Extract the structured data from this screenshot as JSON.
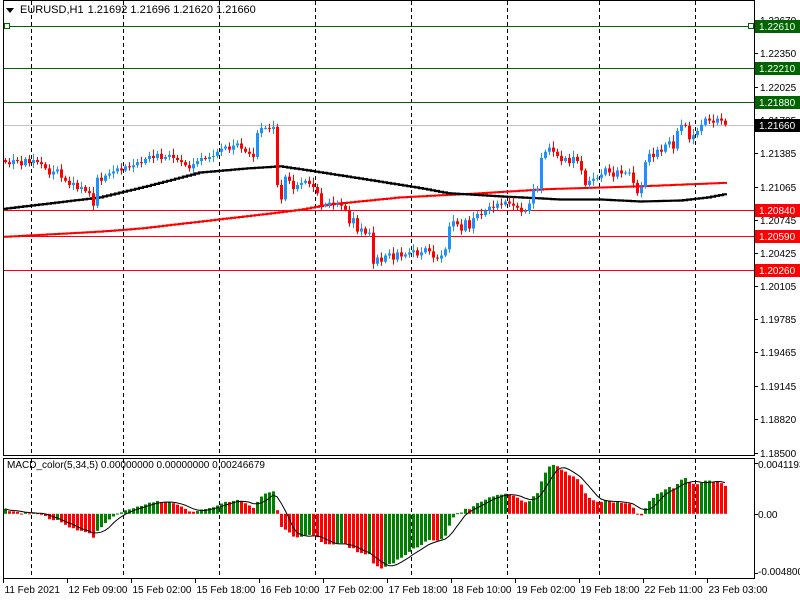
{
  "header": {
    "symbol": "EURUSD,H1",
    "ohlc": "1.21692 1.21696 1.21620 1.21660"
  },
  "colors": {
    "bull": "#1E90FF",
    "bear": "#FF0000",
    "support_level": "#FF0000",
    "resistance_level": "#006400",
    "macd_up": "#008000",
    "macd_down": "#FF0000",
    "ma_black": "#000000",
    "ma_red": "#FF0000",
    "current_price_line": "#C0C0C0"
  },
  "chart_data": {
    "type": "candlestick",
    "title": "EURUSD,H1",
    "first_open": 1.2132,
    "close": [
      1.213,
      1.2128,
      1.2132,
      1.2131,
      1.2127,
      1.2133,
      1.2129,
      1.2132,
      1.213,
      1.2128,
      1.2124,
      1.2118,
      1.2121,
      1.2123,
      1.2115,
      1.2112,
      1.2108,
      1.211,
      1.2104,
      1.2106,
      1.2102,
      1.21,
      1.2088,
      1.2115,
      1.2112,
      1.2117,
      1.2119,
      1.2121,
      1.2124,
      1.2122,
      1.2126,
      1.2125,
      1.2127,
      1.213,
      1.2129,
      1.2133,
      1.2136,
      1.2134,
      1.2138,
      1.2133,
      1.2135,
      1.2137,
      1.2134,
      1.2132,
      1.213,
      1.2127,
      1.2124,
      1.2128,
      1.2131,
      1.2134,
      1.2133,
      1.2135,
      1.2136,
      1.214,
      1.2143,
      1.2145,
      1.2142,
      1.2146,
      1.2148,
      1.2143,
      1.214,
      1.2138,
      1.2135,
      1.2158,
      1.2163,
      1.2163,
      1.2162,
      1.2164,
      1.2108,
      1.2094,
      1.2116,
      1.2112,
      1.2104,
      1.2108,
      1.211,
      1.2112,
      1.2109,
      1.2106,
      1.21,
      1.2088,
      1.2089,
      1.2091,
      1.2089,
      1.209,
      1.2088,
      1.2084,
      1.2071,
      1.2076,
      1.2063,
      1.2066,
      1.2061,
      1.2062,
      1.2032,
      1.2038,
      1.2034,
      1.204,
      1.2042,
      1.2036,
      1.2043,
      1.2039,
      1.2041,
      1.2043,
      1.2045,
      1.204,
      1.2043,
      1.2047,
      1.2044,
      1.2038,
      1.2037,
      1.204,
      1.2046,
      1.2068,
      1.2073,
      1.207,
      1.2064,
      1.2074,
      1.2066,
      1.2076,
      1.208,
      1.2079,
      1.2083,
      1.2087,
      1.2086,
      1.209,
      1.2089,
      1.2092,
      1.209,
      1.2088,
      1.2086,
      1.2082,
      1.2083,
      1.209,
      1.2103,
      1.2104,
      1.2134,
      1.214,
      1.2144,
      1.214,
      1.2136,
      1.2131,
      1.2134,
      1.2129,
      1.2135,
      1.2131,
      1.2122,
      1.2108,
      1.2112,
      1.2114,
      1.2115,
      1.2118,
      1.2124,
      1.212,
      1.2116,
      1.2122,
      1.2119,
      1.212,
      1.212,
      1.211,
      1.21,
      1.2106,
      1.213,
      1.2138,
      1.2135,
      1.2142,
      1.214,
      1.2147,
      1.215,
      1.2143,
      1.216,
      1.2166,
      1.2165,
      1.2152,
      1.2156,
      1.216,
      1.2166,
      1.2172,
      1.217,
      1.2168,
      1.2172,
      1.217,
      1.2166
    ],
    "ma_black": [
      [
        0,
        1.2085
      ],
      [
        24,
        1.2096
      ],
      [
        36,
        1.2107
      ],
      [
        49,
        1.212
      ],
      [
        61,
        1.2124
      ],
      [
        69,
        1.2126
      ],
      [
        76,
        1.2122
      ],
      [
        91,
        1.2113
      ],
      [
        104,
        1.2105
      ],
      [
        111,
        1.21
      ],
      [
        124,
        1.2097
      ],
      [
        139,
        1.2094
      ],
      [
        149,
        1.2094
      ],
      [
        159,
        1.2092
      ],
      [
        169,
        1.2093
      ],
      [
        176,
        1.2096
      ],
      [
        180,
        1.2099
      ]
    ],
    "ma_red": [
      [
        0,
        1.2058
      ],
      [
        24,
        1.2063
      ],
      [
        34,
        1.2066
      ],
      [
        61,
        1.2078
      ],
      [
        74,
        1.2084
      ],
      [
        81,
        1.2089
      ],
      [
        99,
        1.2096
      ],
      [
        119,
        1.21
      ],
      [
        136,
        1.2104
      ],
      [
        161,
        1.2107
      ],
      [
        180,
        1.211
      ]
    ],
    "price_axis": {
      "ylim": [
        1.185,
        1.2267
      ],
      "ticks": [
        "1.22670",
        "1.22350",
        "1.22025",
        "1.21705",
        "1.21385",
        "1.21065",
        "1.20745",
        "1.20425",
        "1.20105",
        "1.19785",
        "1.19465",
        "1.19145",
        "1.18820",
        "1.18500"
      ]
    },
    "levels": [
      {
        "price": "1.22610",
        "kind": "resistance"
      },
      {
        "price": "1.22210",
        "kind": "resistance"
      },
      {
        "price": "1.21880",
        "kind": "resistance"
      },
      {
        "price": "1.20840",
        "kind": "support"
      },
      {
        "price": "1.20590",
        "kind": "support"
      },
      {
        "price": "1.20260",
        "kind": "support"
      }
    ],
    "current_price": "1.21660",
    "time_ticks": [
      {
        "bar": -0.5,
        "label": "11 Feb 2021"
      },
      {
        "bar": 15.5,
        "label": "12 Feb 09:00"
      },
      {
        "bar": 31.5,
        "label": "15 Feb 02:00"
      },
      {
        "bar": 47.5,
        "label": "15 Feb 18:00"
      },
      {
        "bar": 63.5,
        "label": "16 Feb 10:00"
      },
      {
        "bar": 79.5,
        "label": "17 Feb 02:00"
      },
      {
        "bar": 95.5,
        "label": "17 Feb 18:00"
      },
      {
        "bar": 111.5,
        "label": "18 Feb 10:00"
      },
      {
        "bar": 127.5,
        "label": "19 Feb 02:00"
      },
      {
        "bar": 143.5,
        "label": "19 Feb 18:00"
      },
      {
        "bar": 159.5,
        "label": "22 Feb 11:00"
      },
      {
        "bar": 175.5,
        "label": "23 Feb 03:00"
      }
    ],
    "period_separators": [
      6.5,
      29.5,
      53.5,
      77.5,
      101.5,
      125.5,
      148.5,
      172.5
    ],
    "macd": {
      "label": "MACD_color(5,34,5) 0.00000000 0.00000000 0.00246679",
      "fast": 5,
      "slow": 34,
      "signal": 5,
      "ylim": [
        -0.0048,
        0.0041193
      ],
      "ticks": [
        {
          "value": 0.0041193,
          "label": "0.0041193"
        },
        {
          "value": 0,
          "label": "0.00"
        },
        {
          "value": -0.0048,
          "label": "-0.004800"
        }
      ]
    }
  }
}
